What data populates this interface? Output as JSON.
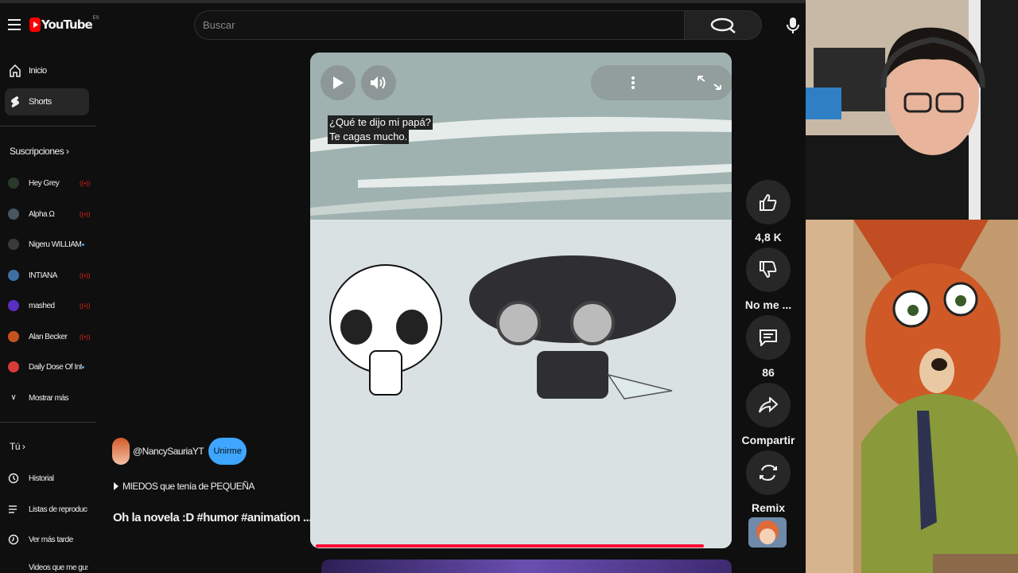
{
  "header": {
    "logo_text": "YouTube",
    "logo_country": "ES",
    "search_placeholder": "Buscar"
  },
  "sidebar": {
    "main": [
      {
        "label": "Inicio",
        "icon": "home-icon",
        "active": false
      },
      {
        "label": "Shorts",
        "icon": "shorts-icon",
        "active": true
      }
    ],
    "subscriptions_title": "Suscripciones",
    "subscriptions": [
      {
        "name": "Hey Grey",
        "indicator": "live"
      },
      {
        "name": "Alpha Ω",
        "indicator": "live"
      },
      {
        "name": "Nigeru WILLIAM",
        "indicator": "new"
      },
      {
        "name": "INTIANA",
        "indicator": "live"
      },
      {
        "name": "mashed",
        "indicator": "live"
      },
      {
        "name": "Alan Becker",
        "indicator": "live"
      },
      {
        "name": "Daily Dose Of Int...",
        "indicator": "new"
      }
    ],
    "show_more": "Mostrar más",
    "you_title": "Tú",
    "you_items": [
      {
        "label": "Historial",
        "icon": "history-icon"
      },
      {
        "label": "Listas de reproducc...",
        "icon": "playlists-icon"
      },
      {
        "label": "Ver más tarde",
        "icon": "watch-later-icon"
      },
      {
        "label": "Videos que me gus...",
        "icon": "liked-icon"
      }
    ]
  },
  "short": {
    "caption_line1": "¿Qué te dijo mi papá?",
    "caption_line2": "Te cagas mucho.",
    "creator_handle": "@NancySauriaYT",
    "join_label": "Unirme",
    "playlist_label": "MIEDOS que tenía de PEQUEÑA",
    "title": "Oh la novela :D  #humor #animation ...",
    "progress": 0.92
  },
  "actions": {
    "likes": "4,8 K",
    "dislike_label": "No me ...",
    "comments": "86",
    "share_label": "Compartir",
    "remix_label": "Remix"
  }
}
